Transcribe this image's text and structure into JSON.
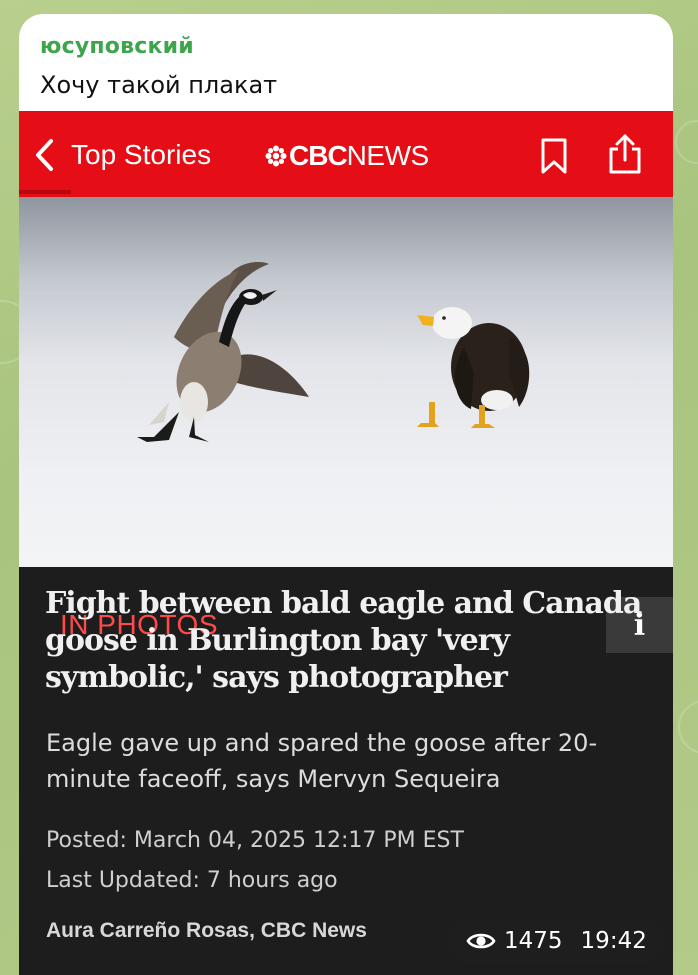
{
  "message": {
    "sender": "юсуповский",
    "caption": "Хочу такой плакат",
    "views": "1475",
    "time": "19:42"
  },
  "app_header": {
    "back_label": "Top Stories",
    "logo_cbc": "CBC",
    "logo_news": "NEWS",
    "icons": {
      "back": "chevron-left-icon",
      "bookmark": "bookmark-icon",
      "share": "share-icon"
    }
  },
  "article": {
    "category_tag": "IN PHOTOS",
    "info_glyph": "i",
    "headline": "Fight between bald eagle and Canada goose in Burlington bay 'very symbolic,' says photographer",
    "deck": "Eagle gave up and spared the goose after 20-minute faceoff, says Mervyn Sequeira",
    "posted": "Posted: March 04, 2025 12:17 PM EST",
    "last_updated": "Last Updated: 7 hours ago",
    "byline": "Aura Carreño Rosas, CBC News"
  },
  "colors": {
    "cbc_red": "#e60e16",
    "sender_green": "#3ea54d",
    "tag_red": "#ff4a4a",
    "panel_dark": "#1d1d1d"
  }
}
